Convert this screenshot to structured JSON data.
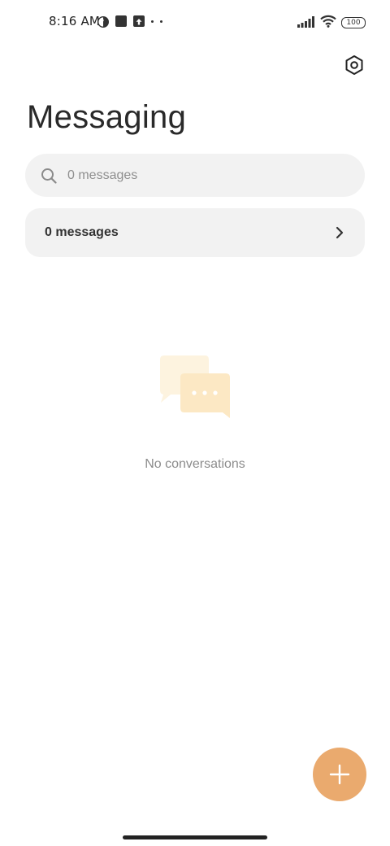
{
  "status_bar": {
    "time": "8:16 AM",
    "battery": "100",
    "icons": [
      "data-saver-icon",
      "square-notification-icon",
      "upload-icon",
      "more-dots-icon",
      "signal-icon",
      "wifi-icon",
      "battery-icon"
    ]
  },
  "header": {
    "title": "Messaging",
    "settings_icon": "settings-hexagon-icon"
  },
  "search": {
    "placeholder": "0 messages",
    "icon": "search-icon"
  },
  "messages_row": {
    "label": "0 messages",
    "icon": "chevron-right-icon"
  },
  "empty_state": {
    "text": "No conversations",
    "icon": "chat-bubbles-illustration"
  },
  "fab": {
    "icon": "plus-icon"
  },
  "colors": {
    "accent": "#eaaa6e",
    "surface": "#f2f2f2",
    "illustration_light": "#fdf3df",
    "illustration_main": "#fce8c4"
  }
}
